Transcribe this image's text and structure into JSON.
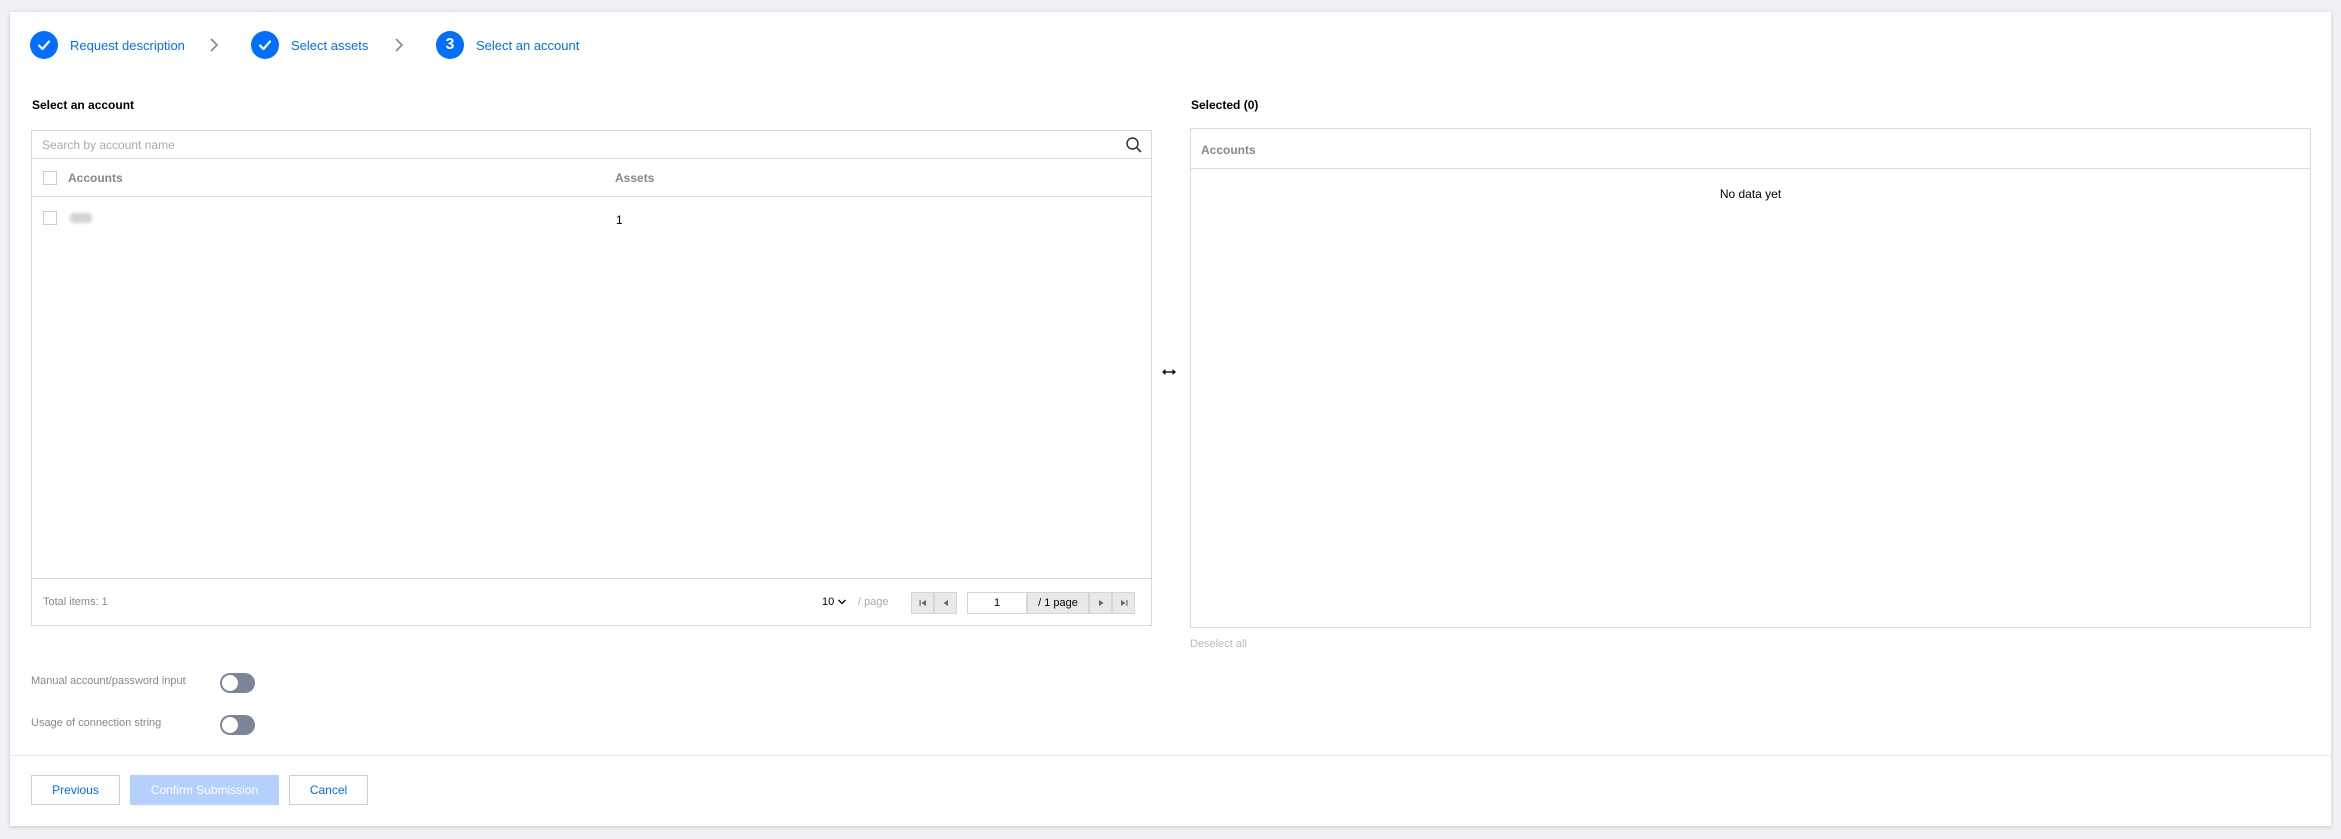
{
  "stepper": {
    "steps": [
      {
        "label": "Request description",
        "state": "done"
      },
      {
        "label": "Select assets",
        "state": "done"
      },
      {
        "label": "Select an account",
        "state": "current",
        "number": "3"
      }
    ]
  },
  "left_panel": {
    "title": "Select an account",
    "search_placeholder": "Search by account name",
    "columns": [
      "Accounts",
      "Assets"
    ],
    "rows": [
      {
        "account": "",
        "assets": "1"
      }
    ],
    "footer": {
      "total_label": "Total items:  1",
      "page_size": "10",
      "per_page_label": "/ page",
      "current_page": "1",
      "page_total": "/ 1 page"
    }
  },
  "right_panel": {
    "title": "Selected  (0)",
    "column": "Accounts",
    "empty_text": "No data yet",
    "deselect_label": "Deselect all"
  },
  "toggles": [
    {
      "label": "Manual account/password input",
      "on": false
    },
    {
      "label": "Usage of connection string",
      "on": false
    }
  ],
  "buttons": {
    "previous": "Previous",
    "confirm": "Confirm Submission",
    "cancel": "Cancel"
  },
  "colors": {
    "accent": "#006eff",
    "disabled_primary": "#b3d0ff",
    "toggle_off": "#7d8598"
  },
  "icons": [
    "check-icon",
    "chevron-right-icon",
    "search-icon",
    "swap-icon",
    "chevron-down-icon",
    "first-page-icon",
    "prev-page-icon",
    "next-page-icon",
    "last-page-icon"
  ]
}
